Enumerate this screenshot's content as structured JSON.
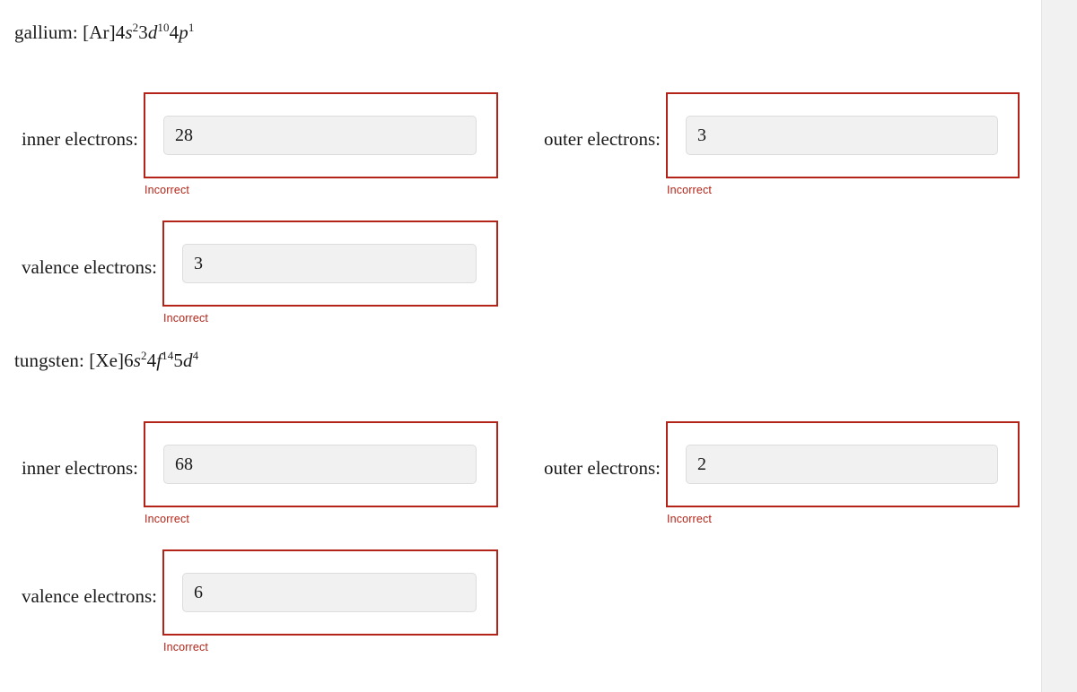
{
  "page": {
    "background_color": "#ffffff",
    "gutter_color": "#f1f1f1",
    "error_color": "#b32317",
    "input_background": "#f1f1f1"
  },
  "elements": [
    {
      "name": "gallium",
      "label_prefix": "gallium: ",
      "noble_core": "[Ar]",
      "configuration_plain": "[Ar]4s²3d¹⁰4p¹",
      "orbitals": [
        {
          "n": "4",
          "letter": "s",
          "exponent": "2"
        },
        {
          "n": "3",
          "letter": "d",
          "exponent": "10"
        },
        {
          "n": "4",
          "letter": "p",
          "exponent": "1"
        }
      ],
      "questions": [
        {
          "label": "inner electrons:",
          "value": "28",
          "feedback": "Incorrect",
          "status": "incorrect",
          "column": "left"
        },
        {
          "label": "outer electrons:",
          "value": "3",
          "feedback": "Incorrect",
          "status": "incorrect",
          "column": "right"
        },
        {
          "label": "valence electrons:",
          "value": "3",
          "feedback": "Incorrect",
          "status": "incorrect",
          "column": "left"
        }
      ]
    },
    {
      "name": "tungsten",
      "label_prefix": "tungsten: ",
      "noble_core": "[Xe]",
      "configuration_plain": "[Xe]6s²4f¹⁴5d⁴",
      "orbitals": [
        {
          "n": "6",
          "letter": "s",
          "exponent": "2"
        },
        {
          "n": "4",
          "letter": "f",
          "exponent": "14"
        },
        {
          "n": "5",
          "letter": "d",
          "exponent": "4"
        }
      ],
      "questions": [
        {
          "label": "inner electrons:",
          "value": "68",
          "feedback": "Incorrect",
          "status": "incorrect",
          "column": "left"
        },
        {
          "label": "outer electrons:",
          "value": "2",
          "feedback": "Incorrect",
          "status": "incorrect",
          "column": "right"
        },
        {
          "label": "valence electrons:",
          "value": "6",
          "feedback": "Incorrect",
          "status": "incorrect",
          "column": "left"
        }
      ]
    }
  ]
}
